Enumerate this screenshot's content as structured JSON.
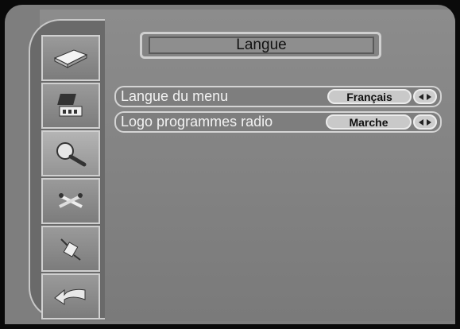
{
  "header": {
    "title": "Langue"
  },
  "sidebar": {
    "items": [
      {
        "icon": "receiver-icon"
      },
      {
        "icon": "tv-antenna-icon"
      },
      {
        "icon": "magnifier-icon",
        "active": true
      },
      {
        "icon": "tools-icon"
      },
      {
        "icon": "satellite-icon"
      },
      {
        "icon": "back-arrow-icon"
      }
    ]
  },
  "settings": [
    {
      "label": "Langue du menu",
      "value": "Français"
    },
    {
      "label": "Logo programmes radio",
      "value": "Marche"
    }
  ]
}
